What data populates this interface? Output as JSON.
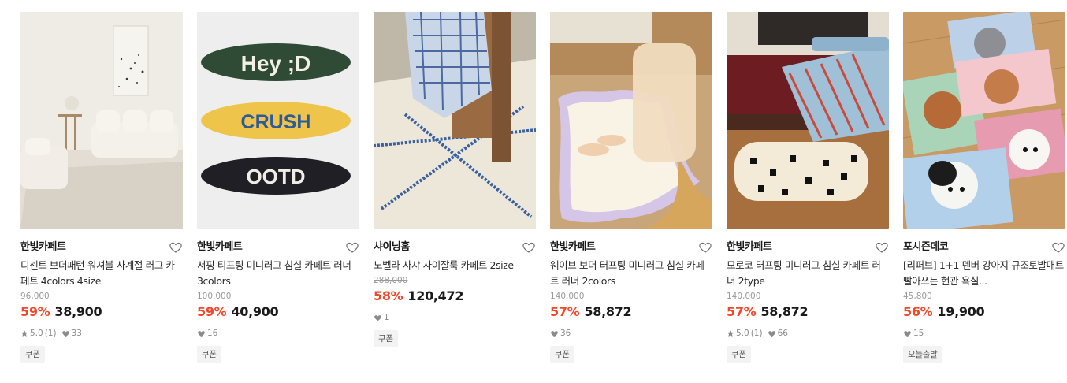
{
  "products": [
    {
      "brand": "한빛카페트",
      "title": "디센트 보더패턴 워셔블 사계절 러그 카페트 4colors 4size",
      "original_price": "96,000",
      "discount": "59%",
      "price": "38,900",
      "rating": "5.0",
      "review_count": "(1)",
      "likes": "33",
      "badge": "쿠폰",
      "image_label": ""
    },
    {
      "brand": "한빛카페트",
      "title": "서핑 티프팅 미니러그 침실 카페트 러너 3colors",
      "original_price": "100,000",
      "discount": "59%",
      "price": "40,900",
      "rating": "",
      "review_count": "",
      "likes": "16",
      "badge": "쿠폰",
      "rug_texts": [
        "Hey ;D",
        "CRUSH",
        "OOTD"
      ]
    },
    {
      "brand": "샤이닝홈",
      "title": "노벨라 사샤 사이잘룩 카페트 2size",
      "original_price": "288,000",
      "discount": "58%",
      "price": "120,472",
      "rating": "",
      "review_count": "",
      "likes": "1",
      "badge": "쿠폰"
    },
    {
      "brand": "한빛카페트",
      "title": "웨이브 보더 터프팅 미니러그 침실 카페트 러너 2colors",
      "original_price": "140,000",
      "discount": "57%",
      "price": "58,872",
      "rating": "",
      "review_count": "",
      "likes": "36",
      "badge": "쿠폰"
    },
    {
      "brand": "한빛카페트",
      "title": "모로코 터프팅 미니러그 침실 카페트 러너 2type",
      "original_price": "140,000",
      "discount": "57%",
      "price": "58,872",
      "rating": "5.0",
      "review_count": "(1)",
      "likes": "66",
      "badge": "쿠폰"
    },
    {
      "brand": "포시즌데코",
      "title": "[리퍼브] 1+1 덴버 강아지 규조토발매트 빨아쓰는 현관 욕실...",
      "original_price": "45,800",
      "discount": "56%",
      "price": "19,900",
      "rating": "",
      "review_count": "",
      "likes": "15",
      "badge": "오늘출발"
    }
  ],
  "colors": {
    "discount": "#f2472b",
    "muted": "#8a8a8a",
    "badge_bg": "#f3f3f3"
  },
  "icons": {
    "wishlist": "heart-outline-icon",
    "rating": "star-icon",
    "likes": "heart-filled-icon"
  }
}
